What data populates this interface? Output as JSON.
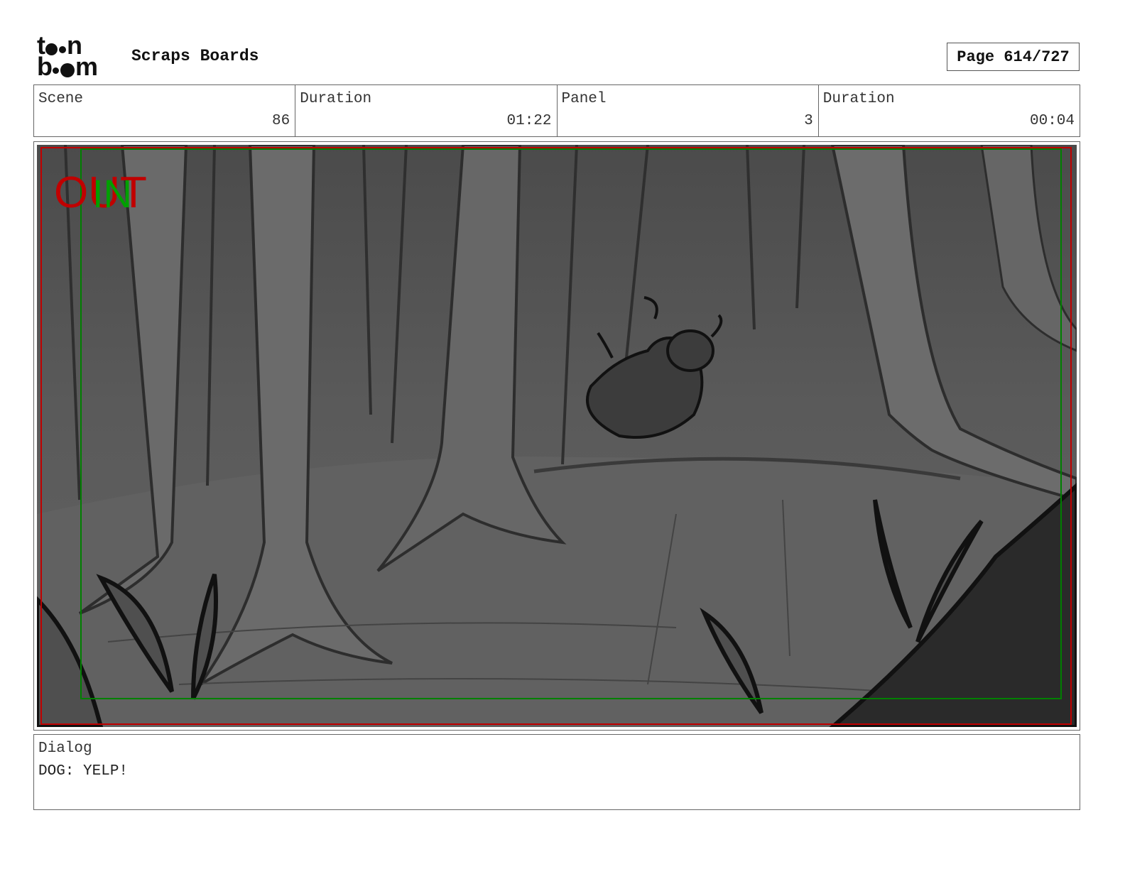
{
  "header": {
    "logo_text": "toon boom",
    "title": "Scraps Boards",
    "page": "Page 614/727"
  },
  "info": [
    {
      "label": "Scene",
      "value": "86"
    },
    {
      "label": "Duration",
      "value": "01:22"
    },
    {
      "label": "Panel",
      "value": "3"
    },
    {
      "label": "Duration",
      "value": "00:04"
    }
  ],
  "panel": {
    "overlay_out": "OUT",
    "overlay_in": "IN",
    "out_color": "#c00000",
    "in_color": "#00a000"
  },
  "dialog": {
    "label": "Dialog",
    "text": "DOG: YELP!"
  }
}
